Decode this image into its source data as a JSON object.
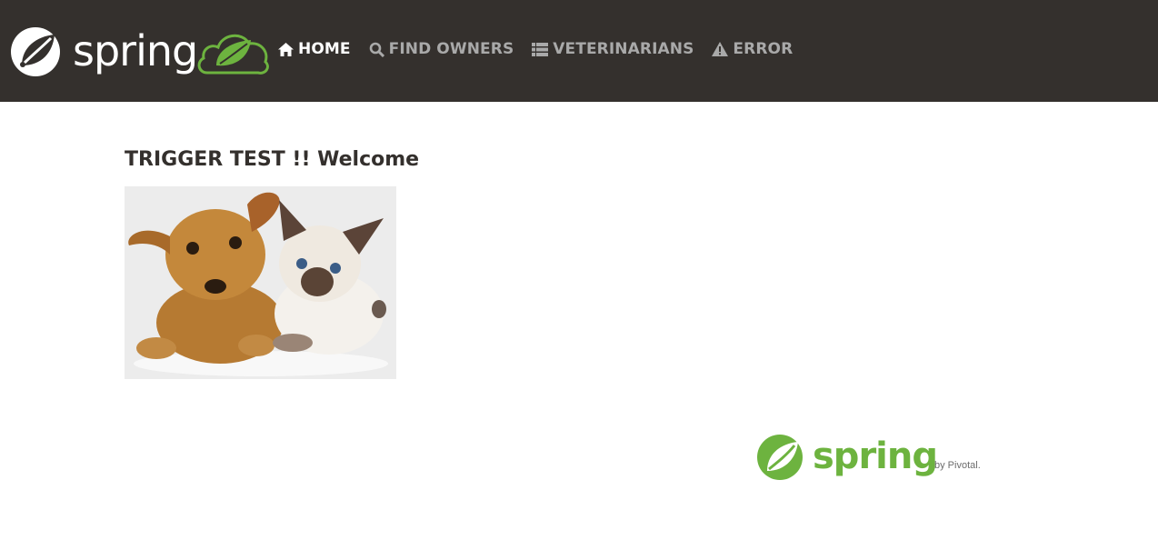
{
  "header": {
    "brand_text": "spring",
    "nav": [
      {
        "label": "HOME",
        "icon": "home-icon",
        "active": true
      },
      {
        "label": "FIND OWNERS",
        "icon": "search-icon",
        "active": false
      },
      {
        "label": "VETERINARIANS",
        "icon": "list-icon",
        "active": false
      },
      {
        "label": "ERROR",
        "icon": "warning-icon",
        "active": false
      }
    ]
  },
  "main": {
    "welcome_text": "TRIGGER TEST !! Welcome",
    "image_subject": "puppy and kitten"
  },
  "footer": {
    "logo_text": "spring",
    "logo_by": "by Pivotal."
  },
  "colors": {
    "navbar_bg": "#34302d",
    "nav_active": "#ffffff",
    "nav_inactive": "#a9a9a9",
    "spring_green": "#6db33f"
  }
}
